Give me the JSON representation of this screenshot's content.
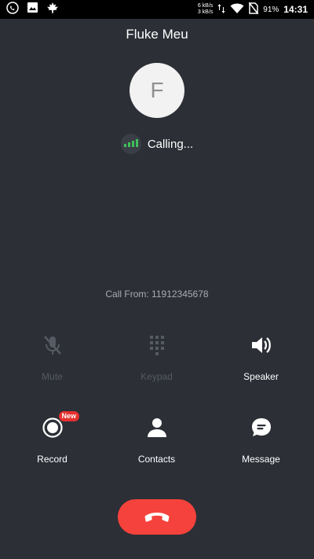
{
  "status_bar": {
    "net_speed_up": "6 kB/s",
    "net_speed_down": "3 kB/s",
    "battery_percent": "91%",
    "time": "14:31"
  },
  "call": {
    "contact_name": "Fluke Meu",
    "avatar_initial": "F",
    "status": "Calling...",
    "call_from": "Call From: 11912345678"
  },
  "controls": {
    "mute": "Mute",
    "keypad": "Keypad",
    "speaker": "Speaker",
    "record": "Record",
    "record_badge": "New",
    "contacts": "Contacts",
    "message": "Message"
  },
  "colors": {
    "background": "#2c2f36",
    "end_call": "#f6423c",
    "signal": "#3fc15a",
    "badge": "#e5302e"
  }
}
